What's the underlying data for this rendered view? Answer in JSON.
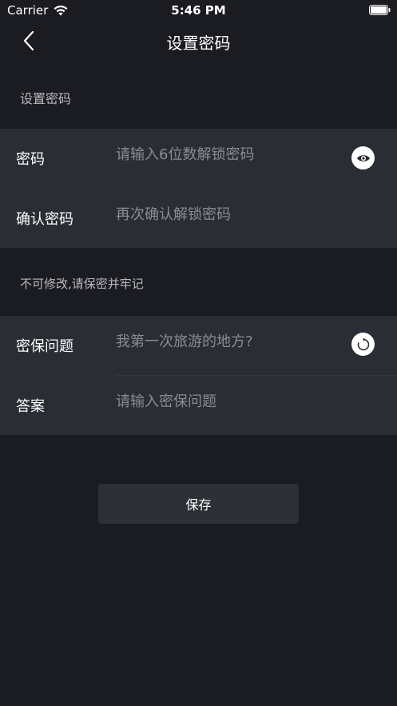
{
  "status_bar": {
    "carrier": "Carrier",
    "time": "5:46 PM"
  },
  "nav": {
    "title": "设置密码",
    "back_icon": "chevron-left-icon"
  },
  "section_header": "设置密码",
  "password_card": {
    "password_label": "密码",
    "password_placeholder": "请输入6位数解锁密码",
    "password_value": "",
    "toggle_icon": "eye-icon",
    "confirm_label": "确认密码",
    "confirm_placeholder": "再次确认解锁密码",
    "confirm_value": ""
  },
  "notice": "不可修改,请保密并牢记",
  "security_card": {
    "question_label": "密保问题",
    "question_placeholder": "我第一次旅游的地方?",
    "question_value": "",
    "refresh_icon": "refresh-icon",
    "answer_label": "答案",
    "answer_placeholder": "请输入密保问题",
    "answer_value": ""
  },
  "save_label": "保存",
  "colors": {
    "background": "#1b1c22",
    "card": "#2a2d34",
    "placeholder": "#8a8c92",
    "button": "#2e3037"
  }
}
